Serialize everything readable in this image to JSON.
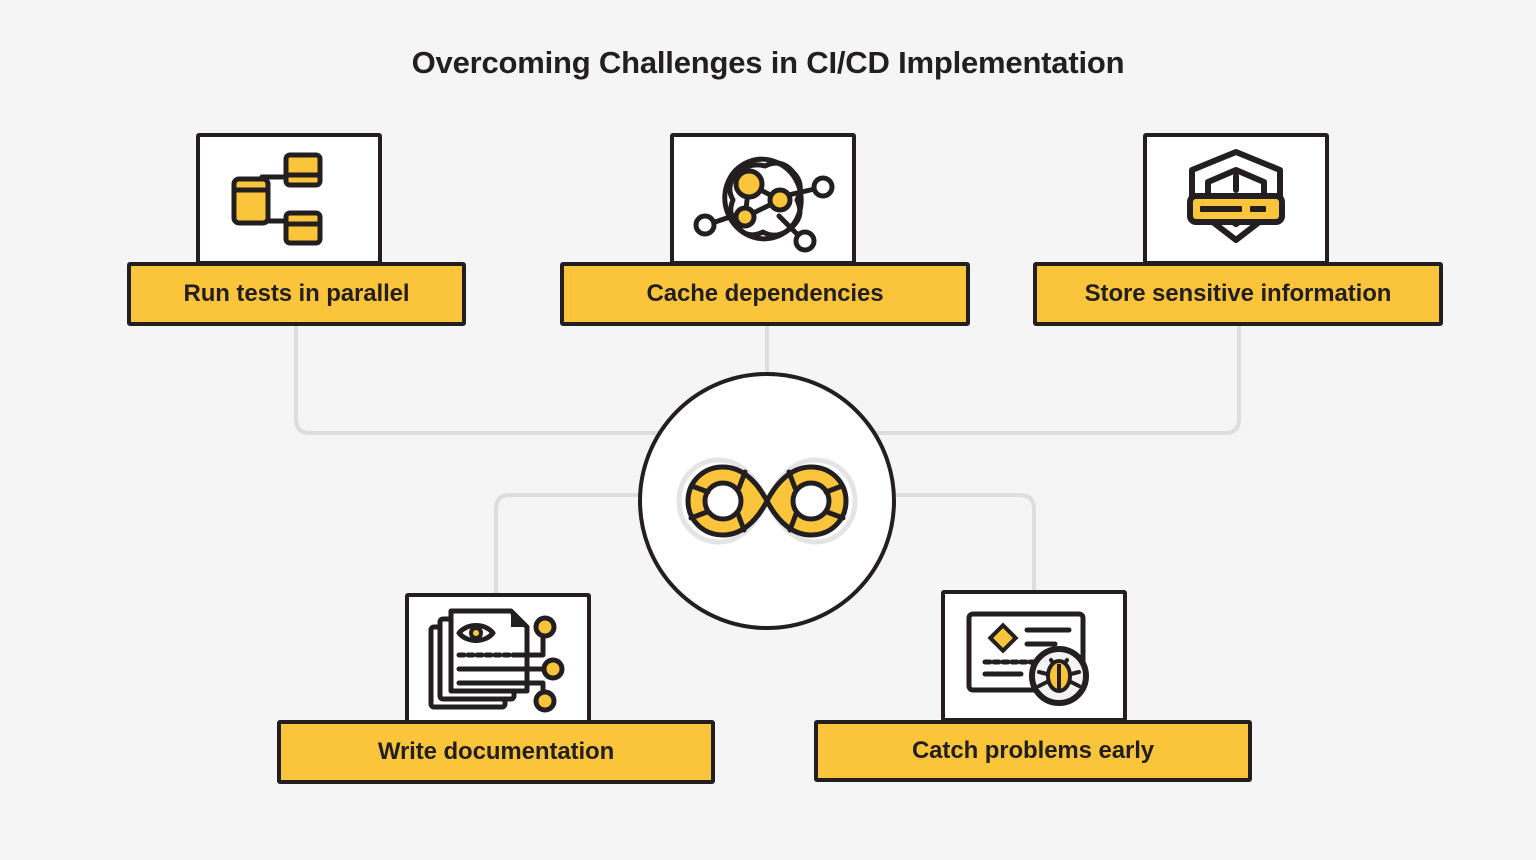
{
  "page": {
    "title": "Overcoming Challenges in CI/CD Implementation",
    "background_color": "#f5f5f5",
    "accent_color": "#fac53b",
    "ink_color": "#231f20",
    "connector_color": "#dddddd"
  },
  "center": {
    "icon": "devops-infinity-loop-icon",
    "label": ""
  },
  "nodes": [
    {
      "id": "run-tests-in-parallel",
      "label": "Run tests in parallel",
      "icon": "parallel-tasks-icon",
      "position": "top-left"
    },
    {
      "id": "cache-dependencies",
      "label": "Cache dependencies",
      "icon": "network-nodes-icon",
      "position": "top-center"
    },
    {
      "id": "store-sensitive-information",
      "label": "Store sensitive information",
      "icon": "shield-lock-icon",
      "position": "top-right"
    },
    {
      "id": "write-documentation",
      "label": "Write documentation",
      "icon": "documents-eye-icon",
      "position": "bottom-left"
    },
    {
      "id": "catch-problems-early",
      "label": "Catch problems early",
      "icon": "code-bug-icon",
      "position": "bottom-right"
    }
  ]
}
